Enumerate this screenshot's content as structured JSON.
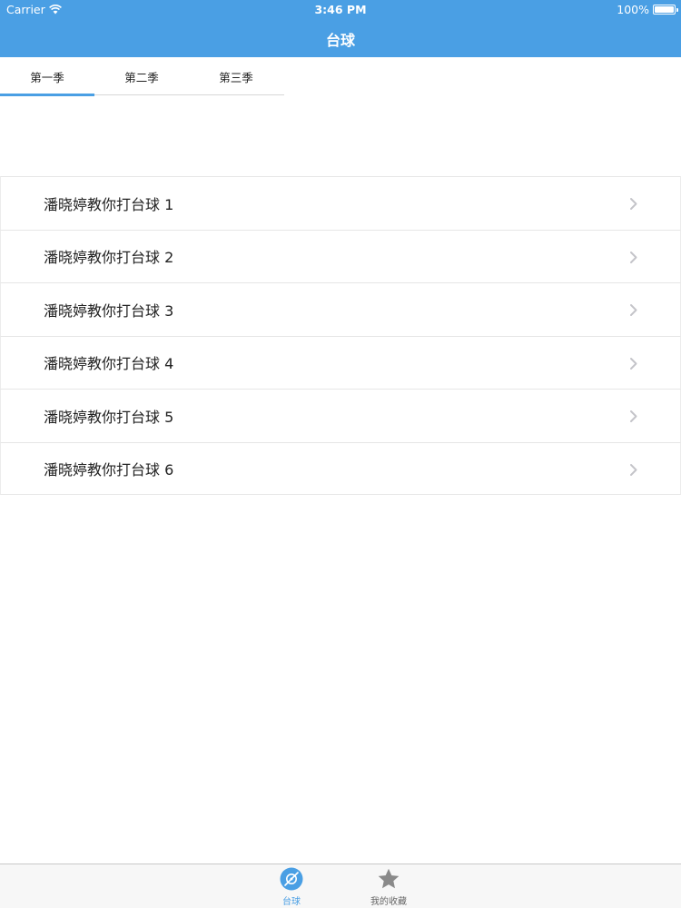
{
  "status_bar": {
    "carrier": "Carrier",
    "time": "3:46 PM",
    "battery": "100%"
  },
  "nav": {
    "title": "台球"
  },
  "season_tabs": [
    {
      "label": "第一季",
      "active": true
    },
    {
      "label": "第二季",
      "active": false
    },
    {
      "label": "第三季",
      "active": false
    }
  ],
  "list": {
    "items": [
      {
        "label": "潘晓婷教你打台球 1"
      },
      {
        "label": "潘晓婷教你打台球 2"
      },
      {
        "label": "潘晓婷教你打台球 3"
      },
      {
        "label": "潘晓婷教你打台球 4"
      },
      {
        "label": "潘晓婷教你打台球 5"
      },
      {
        "label": "潘晓婷教你打台球 6"
      }
    ],
    "chevron_icon": "chevron-right-icon"
  },
  "tab_bar": {
    "items": [
      {
        "label": "台球",
        "icon": "billiards-icon",
        "active": true
      },
      {
        "label": "我的收藏",
        "icon": "star-icon",
        "active": false
      }
    ]
  },
  "colors": {
    "accent": "#4a9fe4",
    "text": "#222222",
    "inactive_icon": "#8a8a8a"
  }
}
